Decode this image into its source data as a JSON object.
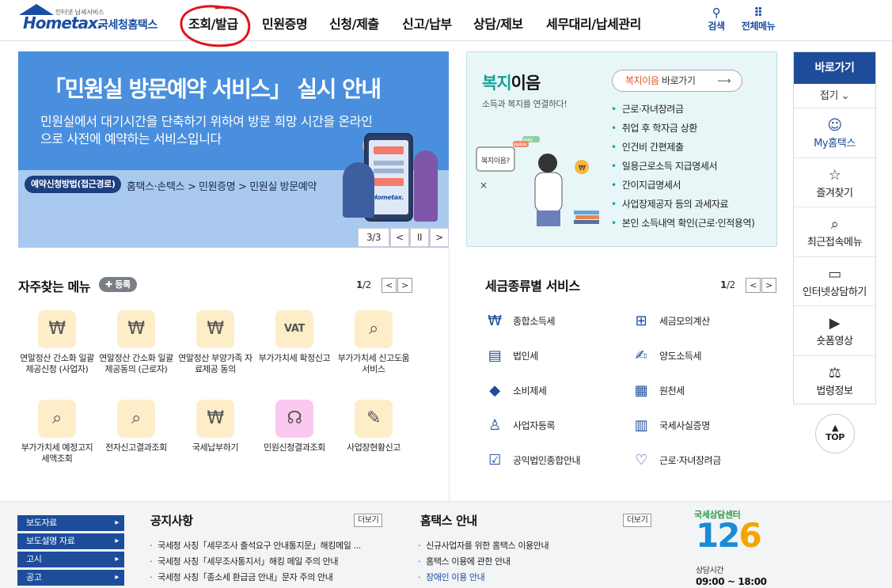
{
  "header": {
    "logo_small": "인터넷 납세서비스",
    "logo_main": "Hometax.",
    "logo_sub": "국세청홈택스",
    "nav": [
      "조회/발급",
      "민원증명",
      "신청/제출",
      "신고/납부",
      "상담/제보",
      "세무대리/납세관리"
    ],
    "search_label": "검색",
    "allmenu_label": "전체메뉴"
  },
  "banner": {
    "title": "「민원실 방문예약 서비스」 실시 안내",
    "desc": "민원실에서 대기시간을 단축하기 위하여 방문 희망 시간을 온라인으로 사전에 예약하는 서비스입니다",
    "badge": "예약신청방법(접근경로)",
    "path": "홈택스·손택스 > 민원증명 > 민원실 방문예약",
    "phone_brand": "Hometax.",
    "page_indicator": "3/3",
    "prev": "<",
    "pause": "II",
    "next": ">"
  },
  "welfare": {
    "title_green": "복지",
    "title_black": "이음",
    "subtitle": "소득과 복지를 연결하다!",
    "link_orange": "복지이음",
    "link_rest": " 바로가기",
    "illus_bubble": "복지이음?",
    "illus_tag1": "apply",
    "illus_tag2": "explore",
    "items": [
      "근로·자녀장려금",
      "취업 후 학자금 상환",
      "인건비 간편제출",
      "일용근로소득 지급명세서",
      "간이지급명세서",
      "사업장제공자 등의 과세자료",
      "본인 소득내역 확인(근로·인적용역)"
    ]
  },
  "quick": {
    "header": "바로가기",
    "fold": "접기",
    "items": [
      {
        "label": "My홈택스",
        "icon": "person-icon"
      },
      {
        "label": "즐겨찾기",
        "icon": "star-icon"
      },
      {
        "label": "최근접속메뉴",
        "icon": "recent-search-icon"
      },
      {
        "label": "인터넷상담하기",
        "icon": "laptop-icon"
      },
      {
        "label": "숏폼영상",
        "icon": "play-icon"
      },
      {
        "label": "법령정보",
        "icon": "gavel-icon"
      }
    ],
    "top": "TOP"
  },
  "favorites": {
    "title": "자주찾는 메뉴",
    "register": "등록",
    "page_current": "1",
    "page_total": "/2",
    "items": [
      {
        "label": "연말정산 간소화 일괄제공신청 (사업자)",
        "icon": "money-bag-icon"
      },
      {
        "label": "연말정산 간소화 일괄제공동의 (근로자)",
        "icon": "money-bag-icon"
      },
      {
        "label": "연말정산 부양가족 자료제공 동의",
        "icon": "money-bag-icon"
      },
      {
        "label": "부가가치세 확정신고",
        "icon": "vat-doc-icon"
      },
      {
        "label": "부가가치세 신고도움 서비스",
        "icon": "won-search-icon"
      },
      {
        "label": "부가가치세 예정고지 세액조회",
        "icon": "won-search-icon"
      },
      {
        "label": "전자신고결과조회",
        "icon": "won-search-icon"
      },
      {
        "label": "국세납부하기",
        "icon": "money-bag-icon"
      },
      {
        "label": "민원신청결과조회",
        "icon": "headset-icon"
      },
      {
        "label": "사업장현황신고",
        "icon": "edit-doc-icon"
      }
    ]
  },
  "taxtypes": {
    "title": "세금종류별 서비스",
    "page_current": "1",
    "page_total": "/2",
    "items": [
      {
        "label": "종합소득세",
        "icon": "won-hand-icon"
      },
      {
        "label": "세금모의계산",
        "icon": "calculator-icon"
      },
      {
        "label": "법인세",
        "icon": "building-icon"
      },
      {
        "label": "양도소득세",
        "icon": "doc-pen-icon"
      },
      {
        "label": "소비제세",
        "icon": "diamond-icon"
      },
      {
        "label": "원천세",
        "icon": "receipt-icon"
      },
      {
        "label": "사업자등록",
        "icon": "business-person-icon"
      },
      {
        "label": "국세사실증명",
        "icon": "document-icon"
      },
      {
        "label": "공익법인종합안내",
        "icon": "clipboard-icon"
      },
      {
        "label": "근로·자녀장려금",
        "icon": "heart-hands-icon"
      }
    ]
  },
  "bottom": {
    "side_buttons": [
      "보도자료",
      "보도설명 자료",
      "고시",
      "공고"
    ],
    "notice_title": "공지사항",
    "notice_more": "더보기",
    "notices": [
      "국세청 사칭「세무조사 출석요구 안내통지문」해킹메일 ...",
      "국세청 사칭「세무조사통지서」해킹 메일 주의 안내",
      "국세청 사칭「종소세 환급금 안내」문자 주의 안내"
    ],
    "guide_title": "홈택스 안내",
    "guide_more": "더보기",
    "guides": [
      "신규사업자를 위한 홈택스 이용안내",
      "홈택스 이용에 관한 안내",
      "장애인 이용 안내"
    ],
    "call_center_title": "국세상담센터",
    "call_center_number_a": "12",
    "call_center_number_b": "6",
    "call_center_hours_label": "상담시간",
    "call_center_hours": "09:00 ~ 18:00"
  },
  "colors": {
    "brand": "#1b4ea3",
    "banner_bg": "#4a8fdd",
    "welfare_green": "#16a29a",
    "welfare_orange": "#e0531c",
    "annotation_red": "#e0151b"
  }
}
